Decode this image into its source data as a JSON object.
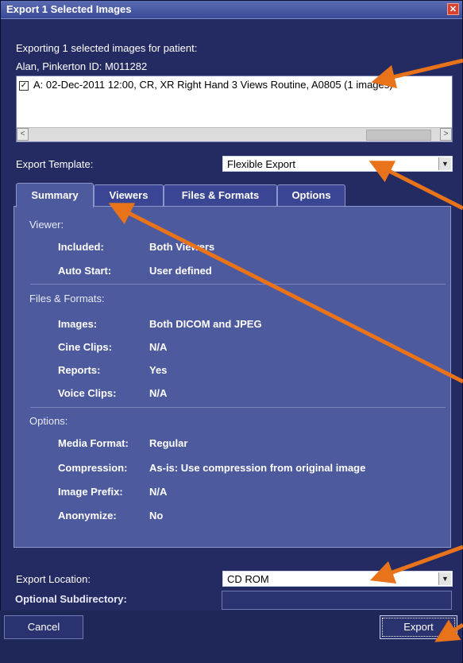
{
  "window": {
    "title": "Export 1 Selected Images",
    "close_glyph": "✕"
  },
  "header": {
    "exporting_text": "Exporting 1 selected images for patient:",
    "patient_line": "Alan, Pinkerton ID: M011282"
  },
  "study_list": {
    "items": [
      {
        "checked": "☑",
        "text": "A: 02-Dec-2011 12:00, CR, XR Right Hand 3 Views Routine, A0805 (1 images)"
      }
    ],
    "scroll_left": "<",
    "scroll_right": ">"
  },
  "template": {
    "label": "Export Template:",
    "value": "Flexible Export",
    "dropdown_glyph": "▼"
  },
  "tabs": [
    {
      "label": "Summary",
      "active": true
    },
    {
      "label": "Viewers",
      "active": false
    },
    {
      "label": "Files & Formats",
      "active": false
    },
    {
      "label": "Options",
      "active": false
    }
  ],
  "summary": {
    "viewer": {
      "heading": "Viewer:",
      "rows": [
        {
          "key": "Included:",
          "value": "Both Viewers"
        },
        {
          "key": "Auto Start:",
          "value": "User defined"
        }
      ]
    },
    "files": {
      "heading": "Files & Formats:",
      "rows": [
        {
          "key": "Images:",
          "value": "Both DICOM and JPEG"
        },
        {
          "key": "Cine Clips:",
          "value": "N/A"
        },
        {
          "key": "Reports:",
          "value": "Yes"
        },
        {
          "key": "Voice Clips:",
          "value": "N/A"
        }
      ]
    },
    "options": {
      "heading": "Options:",
      "rows": [
        {
          "key": "Media Format:",
          "value": "Regular"
        },
        {
          "key": "Compression:",
          "value": "As-is: Use compression from original image"
        },
        {
          "key": "Image Prefix:",
          "value": "N/A"
        },
        {
          "key": "Anonymize:",
          "value": "No"
        }
      ]
    }
  },
  "location": {
    "label": "Export Location:",
    "value": "CD ROM",
    "dropdown_glyph": "▼"
  },
  "subdirectory": {
    "label": "Optional Subdirectory:",
    "value": ""
  },
  "buttons": {
    "cancel": "Cancel",
    "export": "Export"
  },
  "colors": {
    "arrow": "#e8731a",
    "background": "#232b62",
    "panel": "#4d5a9e"
  }
}
